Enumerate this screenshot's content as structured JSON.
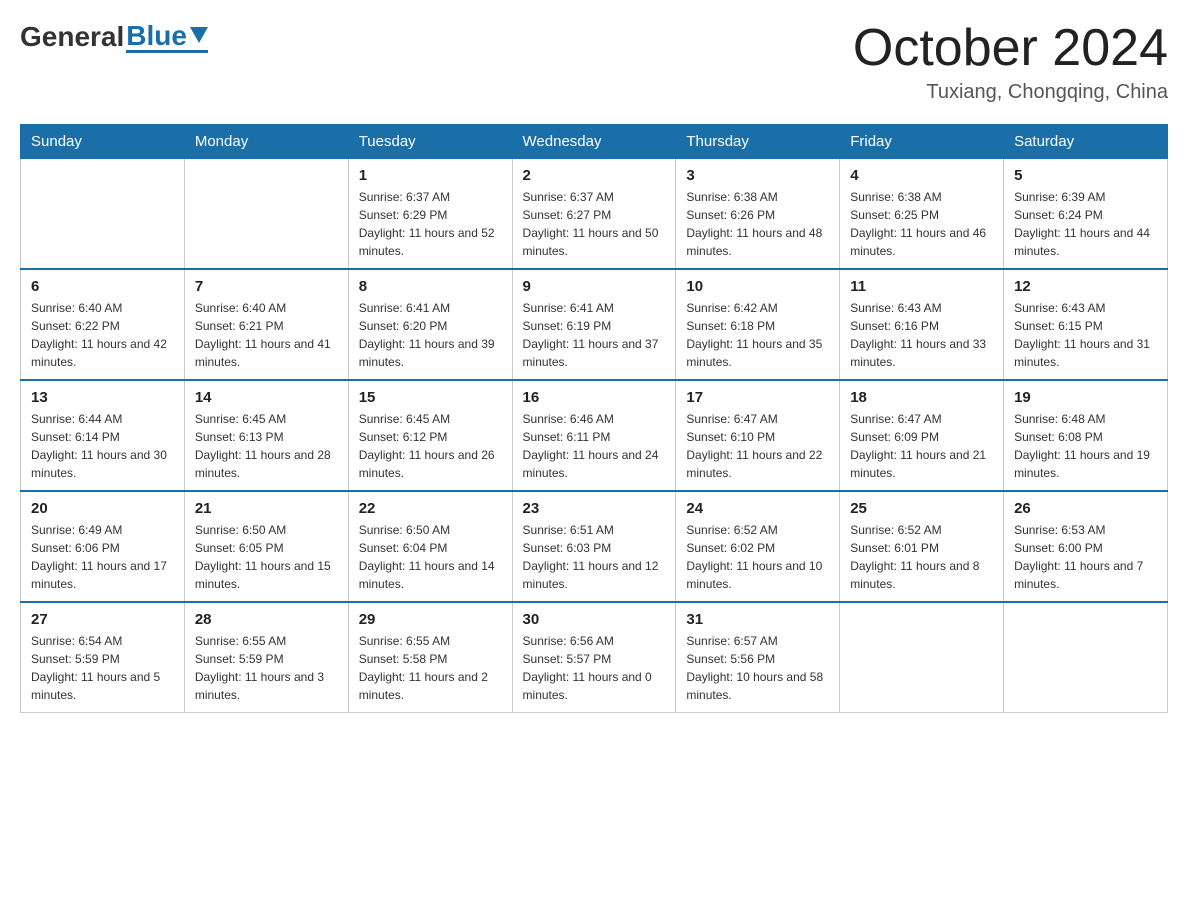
{
  "header": {
    "logo_general": "General",
    "logo_blue": "Blue",
    "main_title": "October 2024",
    "subtitle": "Tuxiang, Chongqing, China"
  },
  "days_of_week": [
    "Sunday",
    "Monday",
    "Tuesday",
    "Wednesday",
    "Thursday",
    "Friday",
    "Saturday"
  ],
  "weeks": [
    [
      {
        "day": "",
        "sunrise": "",
        "sunset": "",
        "daylight": ""
      },
      {
        "day": "",
        "sunrise": "",
        "sunset": "",
        "daylight": ""
      },
      {
        "day": "1",
        "sunrise": "Sunrise: 6:37 AM",
        "sunset": "Sunset: 6:29 PM",
        "daylight": "Daylight: 11 hours and 52 minutes."
      },
      {
        "day": "2",
        "sunrise": "Sunrise: 6:37 AM",
        "sunset": "Sunset: 6:27 PM",
        "daylight": "Daylight: 11 hours and 50 minutes."
      },
      {
        "day": "3",
        "sunrise": "Sunrise: 6:38 AM",
        "sunset": "Sunset: 6:26 PM",
        "daylight": "Daylight: 11 hours and 48 minutes."
      },
      {
        "day": "4",
        "sunrise": "Sunrise: 6:38 AM",
        "sunset": "Sunset: 6:25 PM",
        "daylight": "Daylight: 11 hours and 46 minutes."
      },
      {
        "day": "5",
        "sunrise": "Sunrise: 6:39 AM",
        "sunset": "Sunset: 6:24 PM",
        "daylight": "Daylight: 11 hours and 44 minutes."
      }
    ],
    [
      {
        "day": "6",
        "sunrise": "Sunrise: 6:40 AM",
        "sunset": "Sunset: 6:22 PM",
        "daylight": "Daylight: 11 hours and 42 minutes."
      },
      {
        "day": "7",
        "sunrise": "Sunrise: 6:40 AM",
        "sunset": "Sunset: 6:21 PM",
        "daylight": "Daylight: 11 hours and 41 minutes."
      },
      {
        "day": "8",
        "sunrise": "Sunrise: 6:41 AM",
        "sunset": "Sunset: 6:20 PM",
        "daylight": "Daylight: 11 hours and 39 minutes."
      },
      {
        "day": "9",
        "sunrise": "Sunrise: 6:41 AM",
        "sunset": "Sunset: 6:19 PM",
        "daylight": "Daylight: 11 hours and 37 minutes."
      },
      {
        "day": "10",
        "sunrise": "Sunrise: 6:42 AM",
        "sunset": "Sunset: 6:18 PM",
        "daylight": "Daylight: 11 hours and 35 minutes."
      },
      {
        "day": "11",
        "sunrise": "Sunrise: 6:43 AM",
        "sunset": "Sunset: 6:16 PM",
        "daylight": "Daylight: 11 hours and 33 minutes."
      },
      {
        "day": "12",
        "sunrise": "Sunrise: 6:43 AM",
        "sunset": "Sunset: 6:15 PM",
        "daylight": "Daylight: 11 hours and 31 minutes."
      }
    ],
    [
      {
        "day": "13",
        "sunrise": "Sunrise: 6:44 AM",
        "sunset": "Sunset: 6:14 PM",
        "daylight": "Daylight: 11 hours and 30 minutes."
      },
      {
        "day": "14",
        "sunrise": "Sunrise: 6:45 AM",
        "sunset": "Sunset: 6:13 PM",
        "daylight": "Daylight: 11 hours and 28 minutes."
      },
      {
        "day": "15",
        "sunrise": "Sunrise: 6:45 AM",
        "sunset": "Sunset: 6:12 PM",
        "daylight": "Daylight: 11 hours and 26 minutes."
      },
      {
        "day": "16",
        "sunrise": "Sunrise: 6:46 AM",
        "sunset": "Sunset: 6:11 PM",
        "daylight": "Daylight: 11 hours and 24 minutes."
      },
      {
        "day": "17",
        "sunrise": "Sunrise: 6:47 AM",
        "sunset": "Sunset: 6:10 PM",
        "daylight": "Daylight: 11 hours and 22 minutes."
      },
      {
        "day": "18",
        "sunrise": "Sunrise: 6:47 AM",
        "sunset": "Sunset: 6:09 PM",
        "daylight": "Daylight: 11 hours and 21 minutes."
      },
      {
        "day": "19",
        "sunrise": "Sunrise: 6:48 AM",
        "sunset": "Sunset: 6:08 PM",
        "daylight": "Daylight: 11 hours and 19 minutes."
      }
    ],
    [
      {
        "day": "20",
        "sunrise": "Sunrise: 6:49 AM",
        "sunset": "Sunset: 6:06 PM",
        "daylight": "Daylight: 11 hours and 17 minutes."
      },
      {
        "day": "21",
        "sunrise": "Sunrise: 6:50 AM",
        "sunset": "Sunset: 6:05 PM",
        "daylight": "Daylight: 11 hours and 15 minutes."
      },
      {
        "day": "22",
        "sunrise": "Sunrise: 6:50 AM",
        "sunset": "Sunset: 6:04 PM",
        "daylight": "Daylight: 11 hours and 14 minutes."
      },
      {
        "day": "23",
        "sunrise": "Sunrise: 6:51 AM",
        "sunset": "Sunset: 6:03 PM",
        "daylight": "Daylight: 11 hours and 12 minutes."
      },
      {
        "day": "24",
        "sunrise": "Sunrise: 6:52 AM",
        "sunset": "Sunset: 6:02 PM",
        "daylight": "Daylight: 11 hours and 10 minutes."
      },
      {
        "day": "25",
        "sunrise": "Sunrise: 6:52 AM",
        "sunset": "Sunset: 6:01 PM",
        "daylight": "Daylight: 11 hours and 8 minutes."
      },
      {
        "day": "26",
        "sunrise": "Sunrise: 6:53 AM",
        "sunset": "Sunset: 6:00 PM",
        "daylight": "Daylight: 11 hours and 7 minutes."
      }
    ],
    [
      {
        "day": "27",
        "sunrise": "Sunrise: 6:54 AM",
        "sunset": "Sunset: 5:59 PM",
        "daylight": "Daylight: 11 hours and 5 minutes."
      },
      {
        "day": "28",
        "sunrise": "Sunrise: 6:55 AM",
        "sunset": "Sunset: 5:59 PM",
        "daylight": "Daylight: 11 hours and 3 minutes."
      },
      {
        "day": "29",
        "sunrise": "Sunrise: 6:55 AM",
        "sunset": "Sunset: 5:58 PM",
        "daylight": "Daylight: 11 hours and 2 minutes."
      },
      {
        "day": "30",
        "sunrise": "Sunrise: 6:56 AM",
        "sunset": "Sunset: 5:57 PM",
        "daylight": "Daylight: 11 hours and 0 minutes."
      },
      {
        "day": "31",
        "sunrise": "Sunrise: 6:57 AM",
        "sunset": "Sunset: 5:56 PM",
        "daylight": "Daylight: 10 hours and 58 minutes."
      },
      {
        "day": "",
        "sunrise": "",
        "sunset": "",
        "daylight": ""
      },
      {
        "day": "",
        "sunrise": "",
        "sunset": "",
        "daylight": ""
      }
    ]
  ]
}
